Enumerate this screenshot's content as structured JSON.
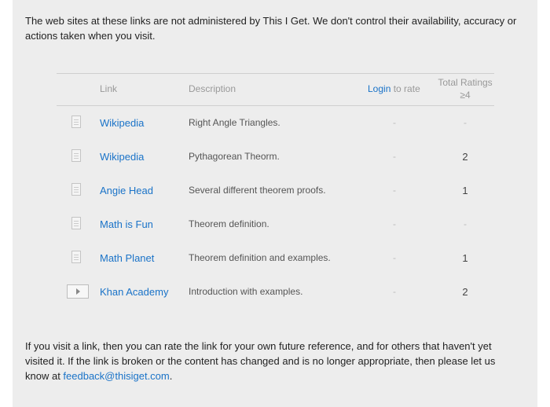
{
  "disclaimer": "The web sites at these links are not administered by This I Get. We don't control their availability, accuracy or actions taken when you visit.",
  "table": {
    "headers": {
      "link": "Link",
      "description": "Description",
      "login": "Login",
      "to_rate": "to rate",
      "total_ratings": "Total Ratings ≥4"
    },
    "rows": [
      {
        "icon": "document-icon",
        "link": "Wikipedia",
        "description": "Right Angle Triangles.",
        "rate": "-",
        "total": "-"
      },
      {
        "icon": "document-icon",
        "link": "Wikipedia",
        "description": "Pythagorean Theorm.",
        "rate": "-",
        "total": "2"
      },
      {
        "icon": "document-icon",
        "link": "Angie Head",
        "description": "Several different theorem proofs.",
        "rate": "-",
        "total": "1"
      },
      {
        "icon": "document-icon",
        "link": "Math is Fun",
        "description": "Theorem definition.",
        "rate": "-",
        "total": "-"
      },
      {
        "icon": "document-icon",
        "link": "Math Planet",
        "description": "Theorem definition and examples.",
        "rate": "-",
        "total": "1"
      },
      {
        "icon": "video-icon",
        "link": "Khan Academy",
        "description": "Introduction with examples.",
        "rate": "-",
        "total": "2"
      }
    ]
  },
  "footer": {
    "text_before": "If you visit a link, then you can rate the link for your own future reference, and for others that haven't yet visited it. If the link is broken or the content has changed and is no longer appropriate, then please let us know at ",
    "email": "feedback@thisiget.com",
    "text_after": "."
  },
  "colors": {
    "link": "#1a73c8",
    "panel_background": "#ededed"
  }
}
